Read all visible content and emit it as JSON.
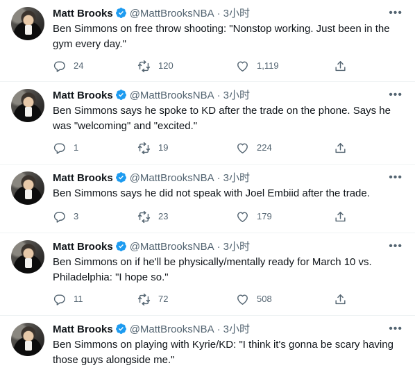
{
  "feed": {
    "author": {
      "name": "Matt Brooks",
      "handle": "@MattBrooksNBA",
      "separator": "·",
      "more_icon": "more-horizontal-icon",
      "verified_icon": "verified-badge-icon"
    },
    "tweets": [
      {
        "time": "3小时",
        "text": "Ben Simmons on free throw shooting: \"Nonstop working. Just been in the gym every day.\"",
        "replies": "24",
        "retweets": "120",
        "likes": "1,119"
      },
      {
        "time": "3小时",
        "text": "Ben Simmons says he spoke to KD after the trade on the phone. Says he was \"welcoming\" and \"excited.\"",
        "replies": "1",
        "retweets": "19",
        "likes": "224"
      },
      {
        "time": "3小时",
        "text": "Ben Simmons says he did not speak with Joel Embiid after the trade.",
        "replies": "3",
        "retweets": "23",
        "likes": "179"
      },
      {
        "time": "3小时",
        "text": "Ben Simmons on if he'll be physically/mentally ready for March 10 vs. Philadelphia: \"I hope so.\"",
        "replies": "11",
        "retweets": "72",
        "likes": "508"
      },
      {
        "time": "3小时",
        "text": "Ben Simmons on playing with Kyrie/KD: \"I think it's gonna be scary having those guys alongside me.\"",
        "replies": null,
        "retweets": null,
        "likes": null
      }
    ],
    "colors": {
      "text": "#0f1419",
      "secondary": "#536471",
      "verified": "#1d9bf0",
      "divider": "#eff3f4"
    }
  }
}
